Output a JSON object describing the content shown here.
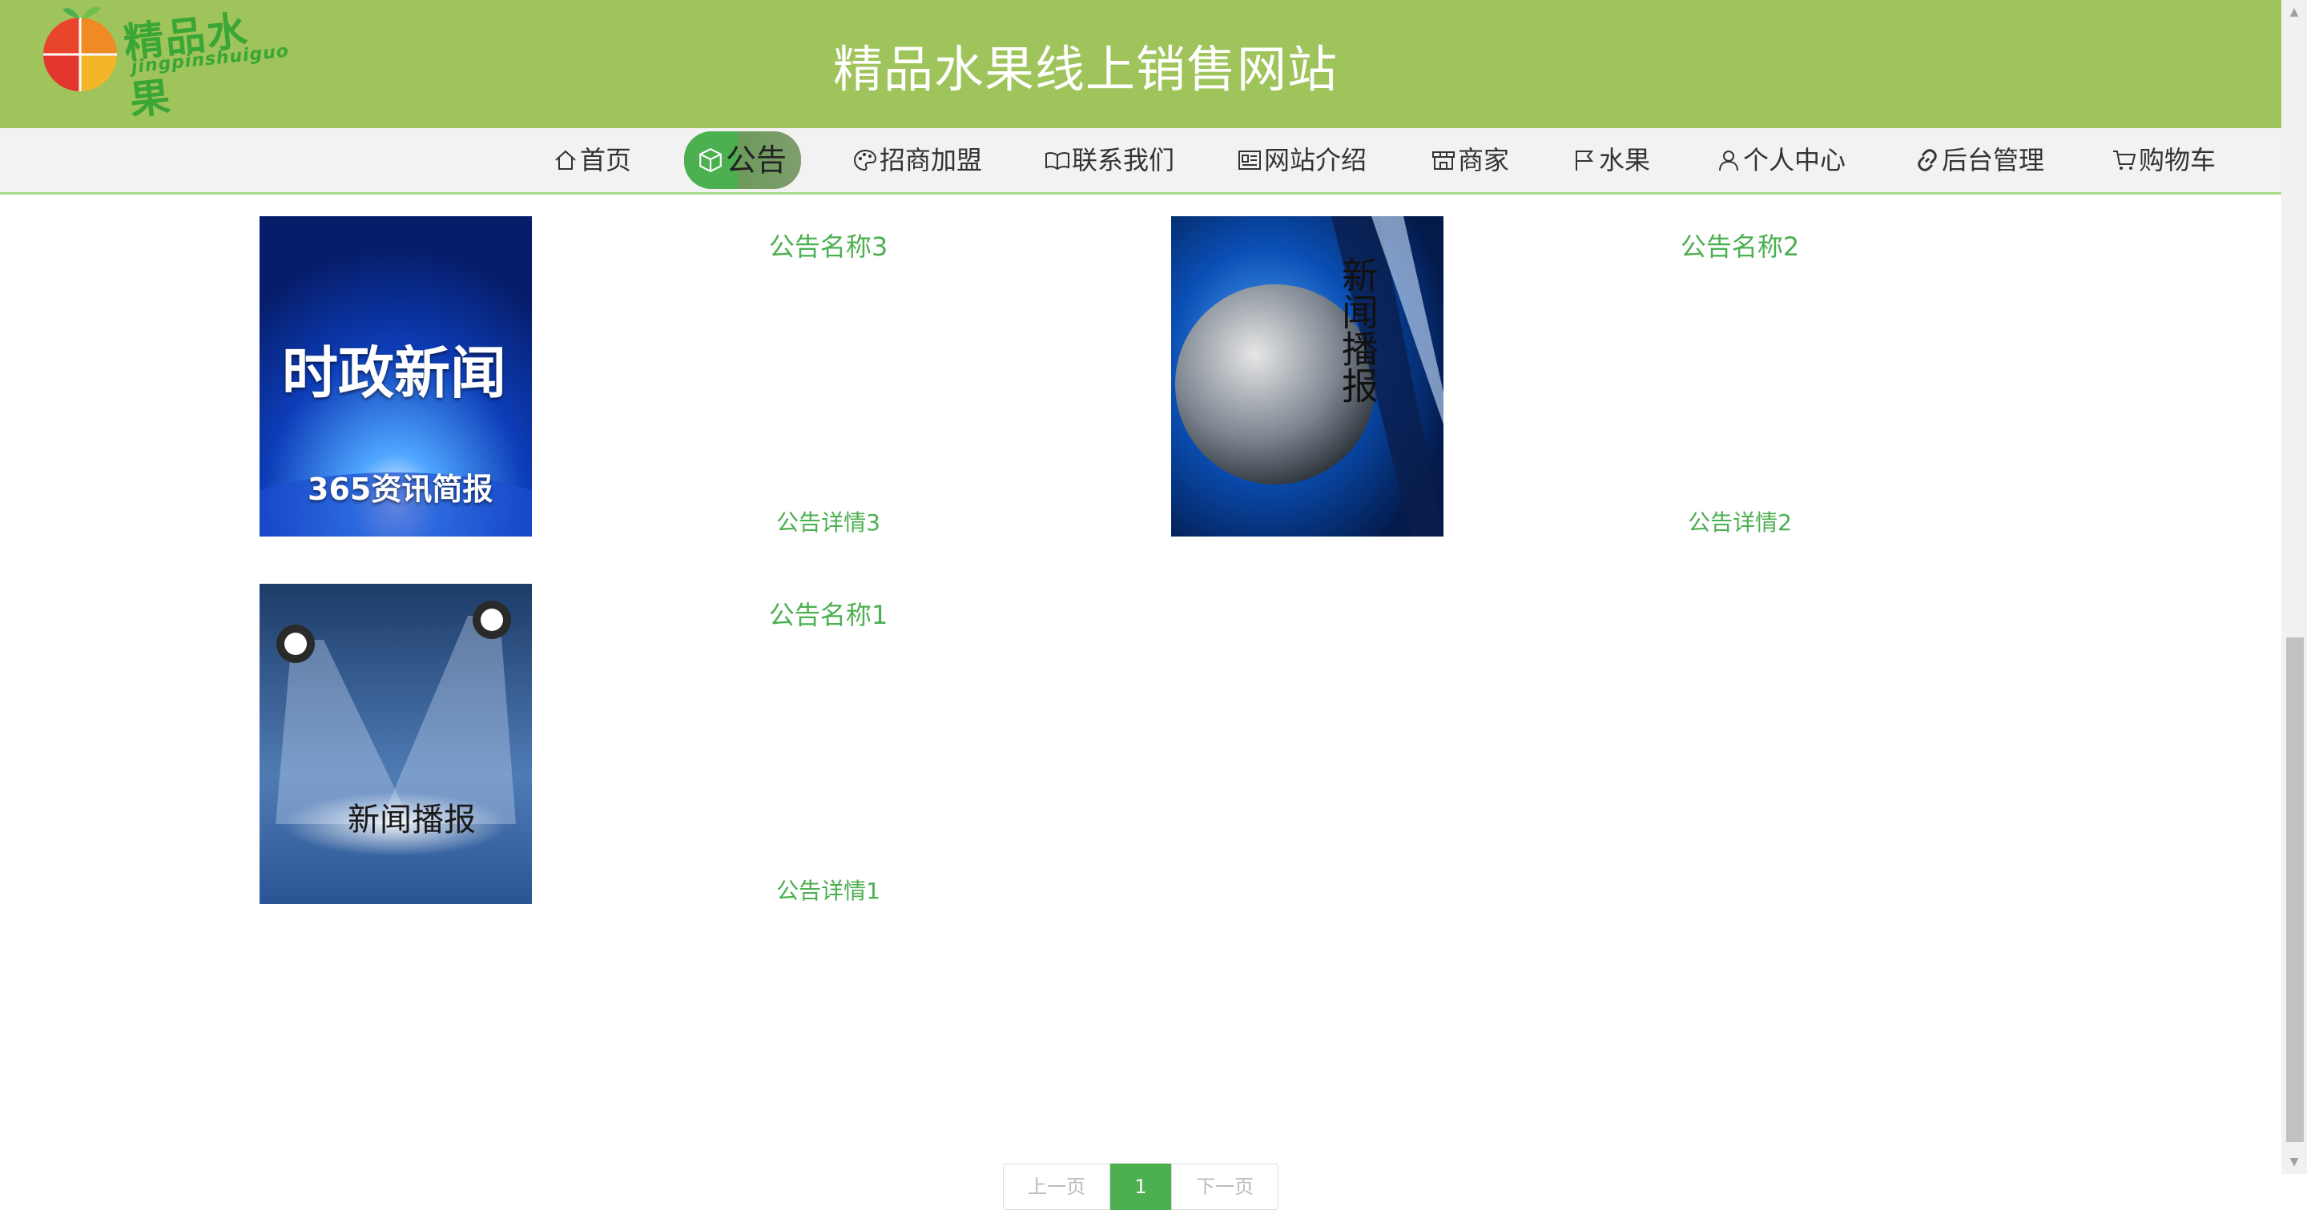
{
  "header": {
    "site_title": "精品水果线上销售网站",
    "logo_cn": "精品水果",
    "logo_pinyin": "jingpinshuiguo"
  },
  "nav": {
    "items": [
      {
        "label": "首页",
        "icon": "home-icon"
      },
      {
        "label": "公告",
        "icon": "cube-icon",
        "active": true
      },
      {
        "label": "招商加盟",
        "icon": "palette-icon"
      },
      {
        "label": "联系我们",
        "icon": "book-icon"
      },
      {
        "label": "网站介绍",
        "icon": "id-card-icon"
      },
      {
        "label": "商家",
        "icon": "store-icon"
      },
      {
        "label": "水果",
        "icon": "flag-icon"
      },
      {
        "label": "个人中心",
        "icon": "user-icon"
      },
      {
        "label": "后台管理",
        "icon": "link-icon"
      },
      {
        "label": "购物车",
        "icon": "cart-icon"
      }
    ]
  },
  "notices": [
    {
      "name": "公告名称3",
      "detail": "公告详情3",
      "image_text_big": "时政新闻",
      "image_text_small": "365资讯简报"
    },
    {
      "name": "公告名称2",
      "detail": "公告详情2",
      "image_text_big": "新闻播报"
    },
    {
      "name": "公告名称1",
      "detail": "公告详情1",
      "image_text_big": "新闻播报"
    }
  ],
  "pagination": {
    "prev_label": "上一页",
    "current_page": "1",
    "next_label": "下一页"
  },
  "colors": {
    "header_bg": "#a0c45c",
    "accent_green": "#4caf50",
    "nav_bg": "#f2f2f2"
  }
}
